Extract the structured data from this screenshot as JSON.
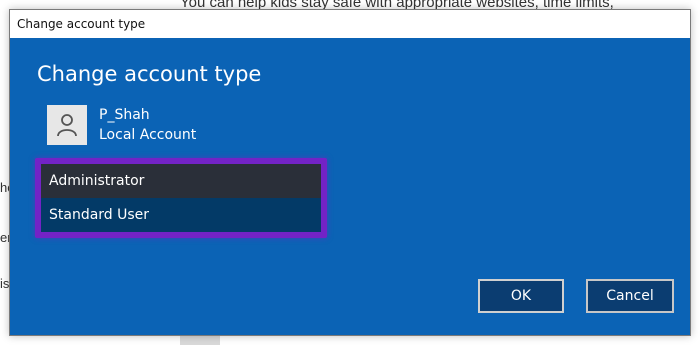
{
  "background": {
    "top_text": "You can help kids stay safe with appropriate websites, time limits,",
    "left_fragments": [
      "he",
      "er",
      "is"
    ]
  },
  "dialog": {
    "window_title": "Change account type",
    "heading": "Change account type",
    "user": {
      "name": "P_Shah",
      "account_type": "Local Account",
      "avatar_icon": "person-icon"
    },
    "account_type_dropdown": {
      "options": [
        "Administrator",
        "Standard User"
      ],
      "selected": "Standard User"
    },
    "buttons": {
      "ok_label": "OK",
      "cancel_label": "Cancel"
    }
  },
  "colors": {
    "dialog_blue": "#0b63b5",
    "button_bg": "#0b3d71",
    "highlight_purple": "#7323c6",
    "dropdown_bg": "#2b2f3a"
  }
}
